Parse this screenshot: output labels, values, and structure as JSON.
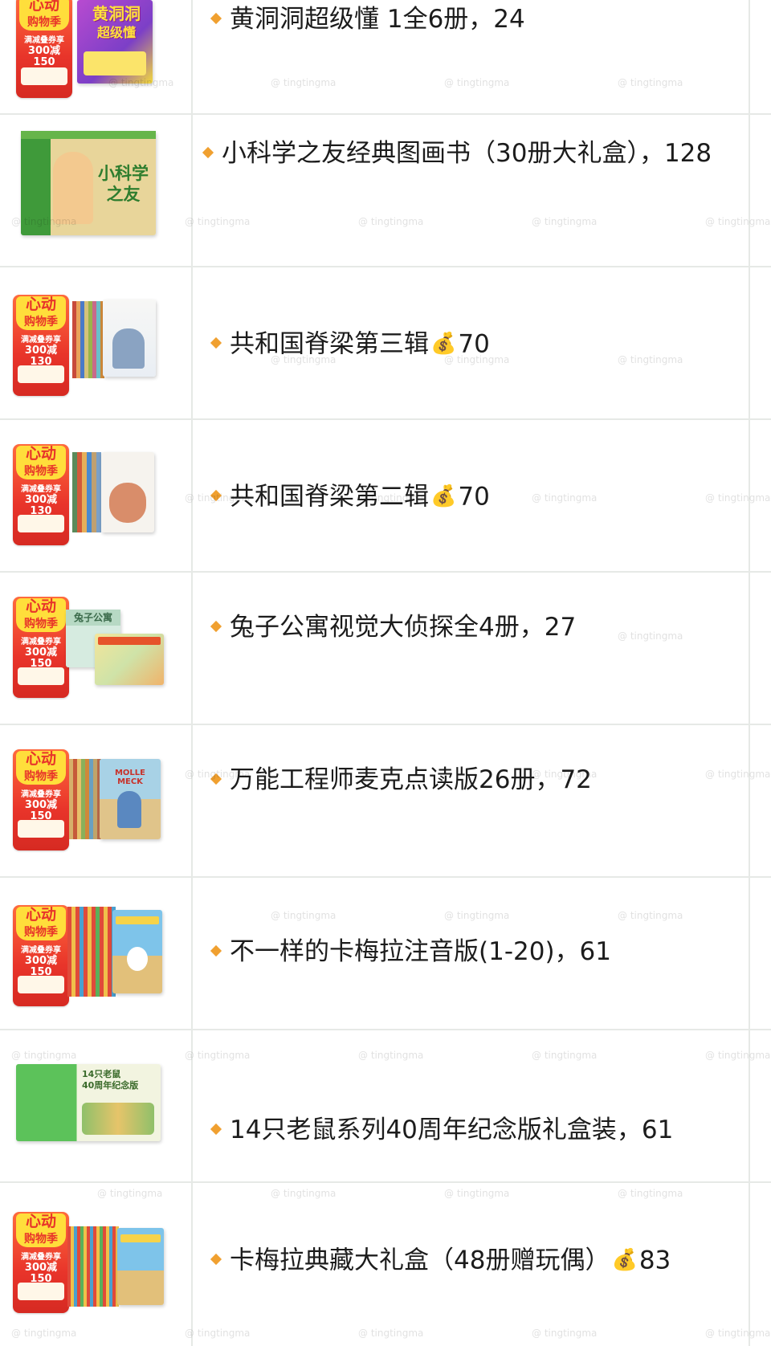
{
  "watermark": "@ tingtingma",
  "promo_badge": {
    "title_line1": "心动",
    "title_line2": "购物季",
    "line1": "满减叠券享",
    "deal_150": "300减150",
    "deal_130": "300减130"
  },
  "items": [
    {
      "id": "item-1",
      "title": "黄洞洞超级懂 1全6册，24",
      "cover_text": "黄洞洞\n超级懂"
    },
    {
      "id": "item-2",
      "title": "小科学之友经典图画书（30册大礼盒），128",
      "cover_text": "小科学\n之友"
    },
    {
      "id": "item-3",
      "title_before": "共和国脊梁第三辑",
      "money_icon": "money-bag-icon",
      "title_after": "70"
    },
    {
      "id": "item-4",
      "title_before": "共和国脊梁第二辑",
      "money_icon": "money-bag-icon",
      "title_after": "70"
    },
    {
      "id": "item-5",
      "title": "兔子公寓视觉大侦探全4册，27",
      "cover_text": "兔子公寓"
    },
    {
      "id": "item-6",
      "title": "万能工程师麦克点读版26册，72",
      "cover_text": "MOLLE MECK"
    },
    {
      "id": "item-7",
      "title": "不一样的卡梅拉注音版(1-20)，61"
    },
    {
      "id": "item-8",
      "title": "14只老鼠系列40周年纪念版礼盒装，61",
      "cover_text": "14只老鼠\n40周年纪念版"
    },
    {
      "id": "item-9",
      "title_before": "卡梅拉典藏大礼盒（48册赠玩偶）",
      "money_icon": "money-bag-icon",
      "title_after": "83"
    }
  ],
  "colors": {
    "bullet": "#f0a030",
    "border": "#e6e9e6",
    "promo_red": "#e8342a",
    "promo_yellow": "#ffde3b"
  }
}
